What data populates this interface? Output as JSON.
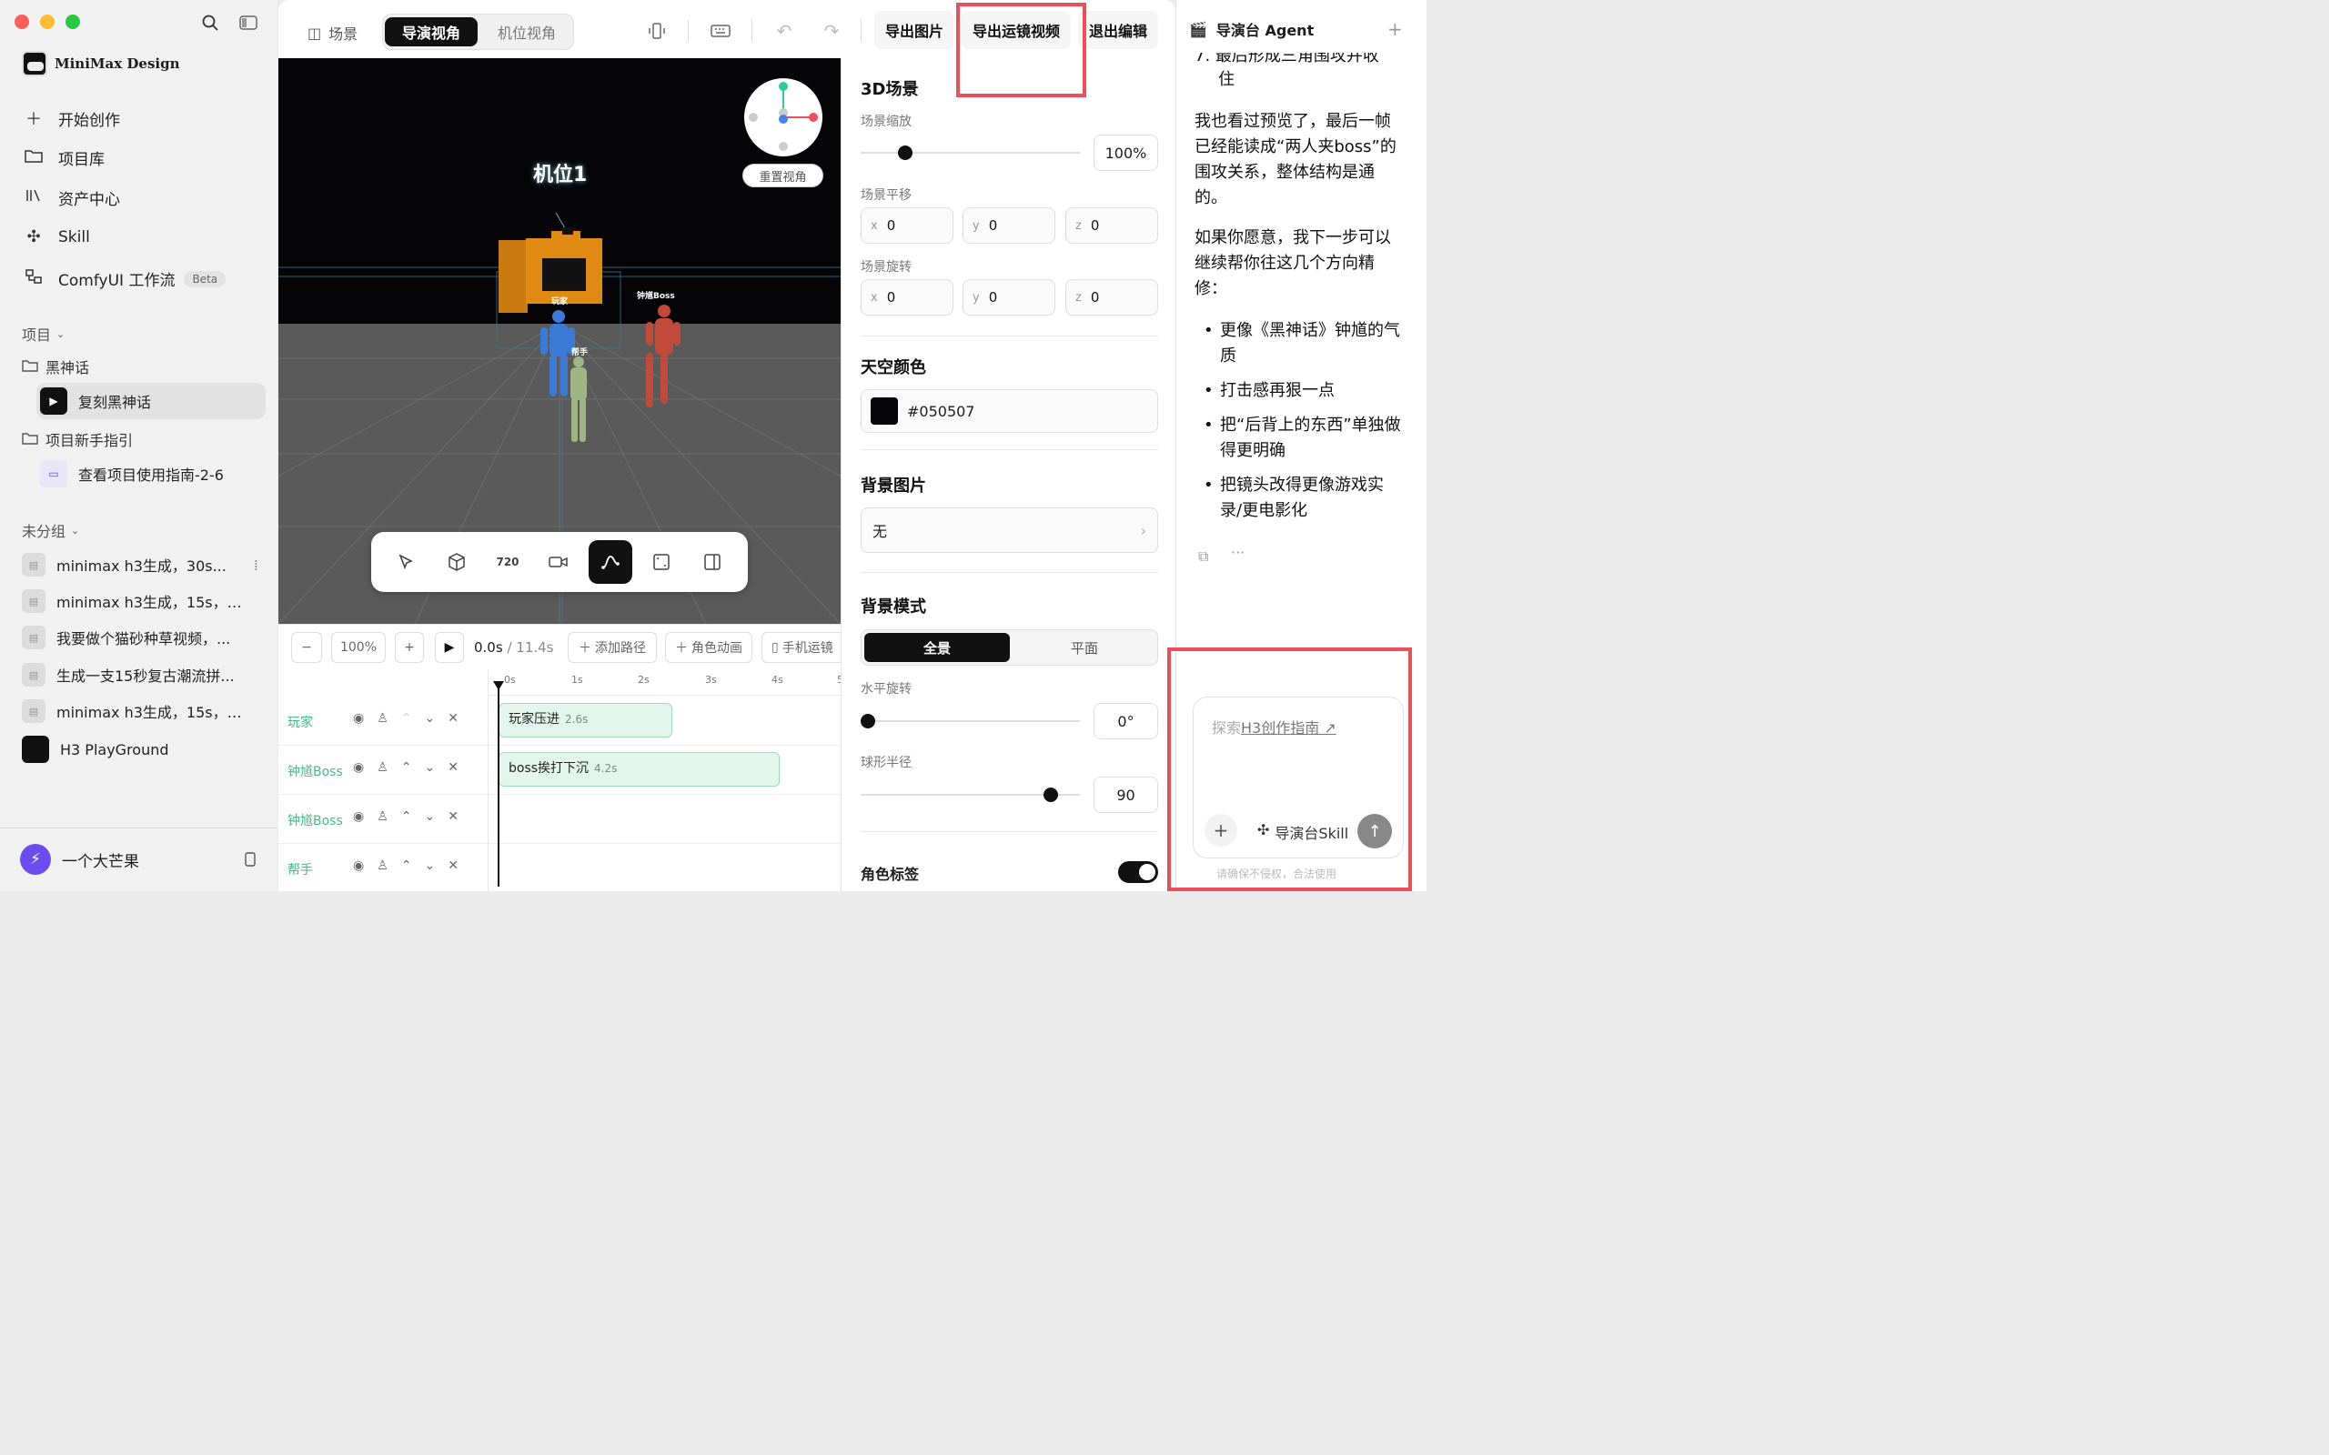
{
  "sidebar": {
    "brand": "MiniMax Design",
    "nav": [
      {
        "label": "开始创作",
        "icon": "plus-icon"
      },
      {
        "label": "项目库",
        "icon": "folder-icon"
      },
      {
        "label": "资产中心",
        "icon": "library-icon"
      },
      {
        "label": "Skill",
        "icon": "puzzle-icon"
      },
      {
        "label": "ComfyUI 工作流",
        "icon": "workflow-icon",
        "badge": "Beta"
      }
    ],
    "projects_title": "项目",
    "folders": [
      {
        "name": "黑神话",
        "items": [
          "复刻黑神话"
        ]
      },
      {
        "name": "项目新手指引",
        "items": [
          "查看项目使用指南-2-6"
        ]
      }
    ],
    "ungrouped_title": "未分组",
    "chats": [
      "minimax h3生成，30s...",
      "minimax h3生成，15s，1...",
      "我要做个猫砂种草视频，...",
      "生成一支15秒复古潮流拼...",
      "minimax h3生成，15s，1..."
    ],
    "playground": "H3 PlayGround",
    "user": "一个大芒果"
  },
  "topbar": {
    "scene_tab": "场景",
    "director_view": "导演视角",
    "camera_view": "机位视角",
    "export_image": "导出图片",
    "export_video": "导出运镜视频",
    "exit_edit": "退出编辑"
  },
  "viewport": {
    "camera_label": "机位1",
    "reset_view": "重置视角",
    "labels": {
      "player": "玩家",
      "boss": "钟馗Boss",
      "helper": "帮手"
    }
  },
  "timeline": {
    "zoom": "100%",
    "current_time": "0.0s",
    "total_time": "/ 11.4s",
    "add_path": "添加路径",
    "char_anim": "角色动画",
    "phone_cam": "手机运镜",
    "ticks": [
      "0s",
      "1s",
      "2s",
      "3s",
      "4s",
      "5"
    ],
    "tracks": [
      {
        "name": "玩家",
        "clip": "玩家压进",
        "dur": "2.6s"
      },
      {
        "name": "钟馗Boss",
        "clip": "boss挨打下沉",
        "dur": "4.2s"
      },
      {
        "name": "钟馗Boss",
        "clip": "",
        "dur": ""
      },
      {
        "name": "帮手",
        "clip": "",
        "dur": ""
      }
    ]
  },
  "panel": {
    "scene_title": "3D场景",
    "scale_label": "场景缩放",
    "scale_value": "100%",
    "pan_label": "场景平移",
    "pan": {
      "x": "0",
      "y": "0",
      "z": "0"
    },
    "rot_label": "场景旋转",
    "rot": {
      "x": "0",
      "y": "0",
      "z": "0"
    },
    "sky_title": "天空颜色",
    "sky_color": "#050507",
    "bg_image_title": "背景图片",
    "bg_image_value": "无",
    "bg_mode_title": "背景模式",
    "mode_full": "全景",
    "mode_flat": "平面",
    "h_rot_label": "水平旋转",
    "h_rot_value": "0°",
    "radius_label": "球形半径",
    "radius_value": "90",
    "char_tag": "角色标签"
  },
  "agent": {
    "title": "导演台 Agent",
    "partial_top": "7. 最后形成三角围攻并收",
    "partial_top2": "住",
    "para1": "我也看过预览了，最后一帧已经能读成“两人夹boss”的围攻关系，整体结构是通的。",
    "para2": "如果你愿意，我下一步可以继续帮你往这几个方向精修：",
    "bullets": [
      "更像《黑神话》钟馗的气质",
      "打击感再狠一点",
      "把“后背上的东西”单独做得更明确",
      "把镜头改得更像游戏实录/更电影化"
    ],
    "input_placeholder": "探索",
    "input_link": "H3创作指南 ↗",
    "skill_label": "导演台Skill",
    "footer_note": "请确保不侵权，合法使用"
  },
  "colors": {
    "highlight": "#ef4d5a",
    "accent_green": "#48b886"
  }
}
